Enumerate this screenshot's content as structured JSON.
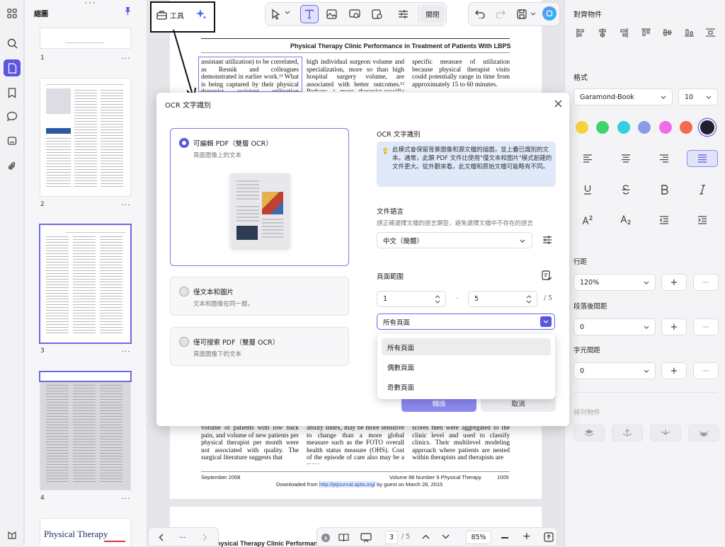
{
  "sidebar": {
    "title": "縮圖"
  },
  "thumbnails": [
    {
      "number": "1"
    },
    {
      "number": "2"
    },
    {
      "number": "3"
    },
    {
      "number": "4"
    }
  ],
  "thumb5_title": "Physical Therapy",
  "thumb_menu": "...",
  "toolbar": {
    "tools_label": "工具",
    "close_label": "關閉"
  },
  "document": {
    "header": "Physical Therapy Clinic Performance in Treatment of Patients With LBPS",
    "col1_top": "assistant utilization) to be correlated, as Resnik and colleagues demonstrated in earlier work.¹³ What is being captured by their physical therapist assistant utilization variable? It",
    "col2_top": "high individual surgeon volume and specialization, more so than high hospital surgery volume, are associated with better outcomes.¹² Perhaps a more therapist-specific and",
    "col3_top": "specific measure of utilization because physical therapist visits could potentially range in time from approximately 15 to 60 minutes.",
    "col1_bottom": "volume of patients with low back pain, and volume of new patients per physical therapist per month were not associated with quality. The surgical literature suggests that",
    "col2_bottom": "ability Index, may be more sensitive to change than a more global measure such as the FOTO overall health status measure (OHS). Cost of the episode of care also may be a more",
    "col3_bottom": "scores then were aggregated to the clinic level and used to classify clinics. Their multilevel modeling approach where patients are nested within therapists and therapists are",
    "footer_date": "September 2008",
    "footer_issue": "Volume 88   Number 9   Physical Therapy",
    "footer_page": "1005",
    "download_prefix": "Downloaded from ",
    "download_link": "http://ptjournal.apta.org/",
    "download_suffix": " by guest on March 28, 2015",
    "next_page_header": "Physical Therapy Clinic Performance in"
  },
  "bottom_bar": {
    "current_page": "3",
    "total_pages": "/ 5",
    "zoom": "85%",
    "more": "..."
  },
  "ocr_dialog": {
    "title": "OCR 文字識別",
    "options": [
      {
        "title": "可編輯 PDF（雙層 OCR）",
        "subtitle": "頁面圖像上的文本",
        "selected": true
      },
      {
        "title": "僅文本和圖片",
        "subtitle": "文本和圖像在同一層。",
        "selected": false
      },
      {
        "title": "僅可搜索 PDF（雙層 OCR）",
        "subtitle": "頁面圖像下的文本",
        "selected": false
      }
    ],
    "section_title": "OCR 文字識別",
    "info_text": "此模式會保留背景圖像和源文檔的插圖，並上疊已識別的文本。通常，此類 PDF 文件比使用\"僅文本和圖片\"模式創建的文件更大。從外觀來看，此文檔和原始文檔可能略有不同。",
    "language_label": "文件語言",
    "language_hint": "請正確選擇文檔的語言類型，避免選擇文檔中不存在的語言",
    "language_value": "中文（簡體）",
    "range_label": "頁面範圍",
    "range_from": "1",
    "range_dash": "-",
    "range_to": "5",
    "range_total": "/ 5",
    "range_select": "所有頁面",
    "dropdown_options": [
      "所有頁面",
      "偶數頁面",
      "奇數頁面"
    ],
    "convert_label": "轉換",
    "cancel_label": "取消"
  },
  "right_panel": {
    "align_title": "對齊物件",
    "format_title": "格式",
    "font_name": "Garamond-Book",
    "font_size": "10",
    "colors": [
      "#f7d23e",
      "#3fd46b",
      "#33cfe0",
      "#8b9be8",
      "#ef6ee8",
      "#f06b4f",
      "#1f1f2e"
    ],
    "line_spacing_label": "行距",
    "line_spacing_value": "120%",
    "para_spacing_label": "段落後間距",
    "para_spacing_value": "0",
    "char_spacing_label": "字元間距",
    "char_spacing_value": "0",
    "arrange_label": "排列物件"
  },
  "accent": "#5a56e0"
}
